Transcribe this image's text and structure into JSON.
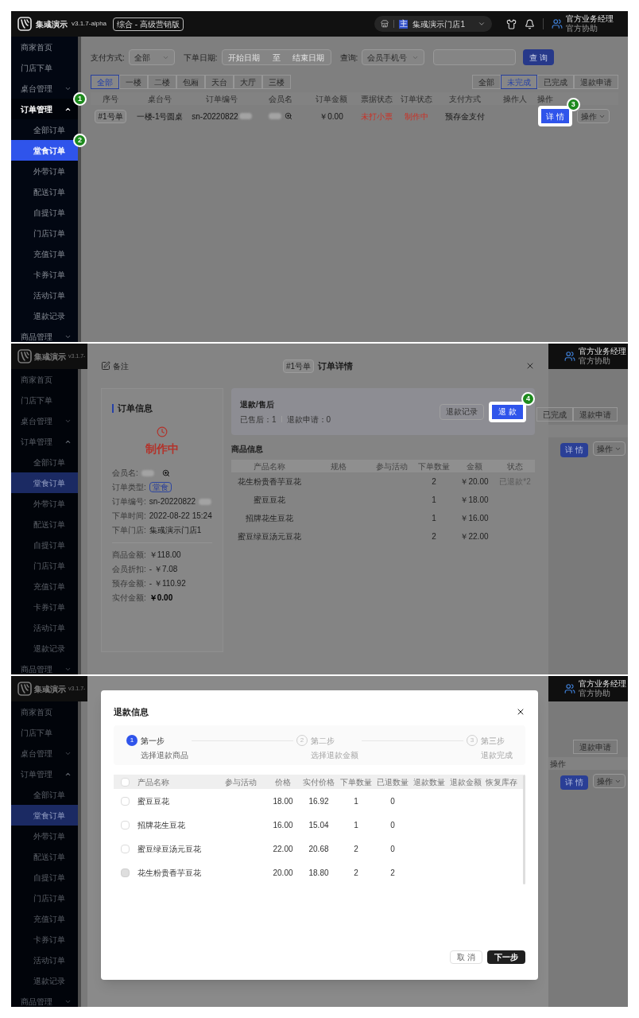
{
  "list_screen": {
    "header": {
      "app_name": "集彧演示",
      "version": "v3.1.7-alpha",
      "edition": "综合 - 高级营销版",
      "store_badge": "主",
      "store": "集彧演示门店1",
      "user_name": "官方业务经理",
      "user_role": "官方协助"
    },
    "sidebar": [
      {
        "kind": "link",
        "label": "商家首页",
        "selected": false
      },
      {
        "kind": "link",
        "label": "门店下单",
        "selected": false
      },
      {
        "kind": "group",
        "label": "桌台管理",
        "expanded": false
      },
      {
        "kind": "group",
        "label": "订单管理",
        "expanded": true,
        "marker": "1",
        "children": [
          {
            "kind": "link",
            "label": "全部订单",
            "selected": false
          },
          {
            "kind": "link",
            "label": "堂食订单",
            "selected": true,
            "marker": "2"
          },
          {
            "kind": "link",
            "label": "外带订单",
            "selected": false
          },
          {
            "kind": "link",
            "label": "配送订单",
            "selected": false
          },
          {
            "kind": "link",
            "label": "自提订单",
            "selected": false
          },
          {
            "kind": "link",
            "label": "门店订单",
            "selected": false
          },
          {
            "kind": "link",
            "label": "充值订单",
            "selected": false
          },
          {
            "kind": "link",
            "label": "卡券订单",
            "selected": false
          },
          {
            "kind": "link",
            "label": "活动订单",
            "selected": false
          },
          {
            "kind": "link",
            "label": "退款记录",
            "selected": false
          }
        ]
      },
      {
        "kind": "group",
        "label": "商品管理",
        "expanded": false
      }
    ],
    "filters": [
      {
        "kind": "select",
        "label": "支付方式:",
        "value": "全部"
      },
      {
        "kind": "date_range",
        "label": "下单日期:",
        "start_placeholder": "开始日期",
        "separator": "至",
        "end_placeholder": "结束日期"
      },
      {
        "kind": "select",
        "label": "查询:",
        "value": "会员手机号"
      },
      {
        "kind": "text"
      }
    ],
    "search_button": "查 询",
    "area_tabs": [
      {
        "label": "全部",
        "selected": true
      },
      {
        "label": "一楼",
        "selected": false
      },
      {
        "label": "二楼",
        "selected": false
      },
      {
        "label": "包厢",
        "selected": false
      },
      {
        "label": "天台",
        "selected": false
      },
      {
        "label": "大厅",
        "selected": false
      },
      {
        "label": "三楼",
        "selected": false
      }
    ],
    "status_tabs": [
      {
        "label": "全部",
        "selected": false
      },
      {
        "label": "未完成",
        "selected": true
      },
      {
        "label": "已完成",
        "selected": false
      },
      {
        "label": "退款申请",
        "selected": false
      }
    ],
    "table": {
      "columns": [
        "序号",
        "桌台号",
        "订单编号",
        "会员名",
        "订单金额",
        "票据状态",
        "订单状态",
        "支付方式",
        "操作人",
        "操作"
      ],
      "rows": [
        {
          "cells": [
            {
              "kind": "tag",
              "text": "#1号单"
            },
            {
              "kind": "text",
              "text": "一楼-1号圆桌"
            },
            {
              "kind": "text",
              "text": "sn-20220822",
              "redacted": true
            },
            {
              "kind": "member",
              "redacted": true
            },
            {
              "kind": "text",
              "text": "￥0.00"
            },
            {
              "kind": "alert_text",
              "text": "未打小票"
            },
            {
              "kind": "alert_text",
              "text": "制作中"
            },
            {
              "kind": "text",
              "text": "预存金支付"
            },
            {
              "kind": "empty"
            },
            {
              "kind": "actions",
              "buttons": [
                {
                  "label": "详 情",
                  "kind": "primary",
                  "marker": "3"
                },
                {
                  "label": "操作",
                  "kind": "dropdown"
                }
              ]
            }
          ]
        }
      ]
    }
  },
  "detail_screen": {
    "header": {
      "app_name": "集彧演示",
      "version": "v3.1.7-",
      "user_name": "官方业务经理",
      "user_role": "官方协助"
    },
    "sidebar": [
      {
        "kind": "link",
        "label": "商家首页",
        "selected": false
      },
      {
        "kind": "link",
        "label": "门店下单",
        "selected": false
      },
      {
        "kind": "group",
        "label": "桌台管理",
        "expanded": false
      },
      {
        "kind": "group",
        "label": "订单管理",
        "expanded": true,
        "children": [
          {
            "kind": "link",
            "label": "全部订单",
            "selected": false
          },
          {
            "kind": "link",
            "label": "堂食订单",
            "selected": true
          },
          {
            "kind": "link",
            "label": "外带订单",
            "selected": false
          },
          {
            "kind": "link",
            "label": "配送订单",
            "selected": false
          },
          {
            "kind": "link",
            "label": "自提订单",
            "selected": false
          },
          {
            "kind": "link",
            "label": "门店订单",
            "selected": false
          },
          {
            "kind": "link",
            "label": "充值订单",
            "selected": false
          },
          {
            "kind": "link",
            "label": "卡券订单",
            "selected": false
          },
          {
            "kind": "link",
            "label": "活动订单",
            "selected": false
          },
          {
            "kind": "link",
            "label": "退款记录",
            "selected": false
          }
        ]
      },
      {
        "kind": "group",
        "label": "商品管理",
        "expanded": false
      }
    ],
    "right_strip": {
      "status_tabs": [
        {
          "label": "已完成",
          "selected": false
        },
        {
          "label": "退款申请",
          "selected": false
        }
      ],
      "row_buttons": [
        {
          "label": "详 情",
          "kind": "primary"
        },
        {
          "label": "操作",
          "kind": "dropdown"
        }
      ]
    },
    "modal": {
      "note_label": "备注",
      "order_tag": "#1号单",
      "title": "订单详情",
      "info_title": "订单信息",
      "status": "制作中",
      "fields": [
        {
          "label": "会员名:",
          "kind": "member",
          "redacted": true
        },
        {
          "label": "订单类型:",
          "kind": "tag",
          "value": "堂食"
        },
        {
          "label": "订单编号:",
          "kind": "text",
          "value": "sn-20220822",
          "redacted": true
        },
        {
          "label": "下单时间:",
          "kind": "text",
          "value": "2022-08-22 15:24"
        },
        {
          "label": "下单门店:",
          "kind": "text",
          "value": "集彧演示门店1"
        }
      ],
      "amounts": [
        {
          "label": "商品金额:",
          "value": "￥118.00",
          "emphasis": false
        },
        {
          "label": "会员折扣:",
          "value": "- ￥7.08",
          "emphasis": false
        },
        {
          "label": "预存金额:",
          "value": "- ￥110.92",
          "emphasis": false
        },
        {
          "label": "实付金额:",
          "value": "￥0.00",
          "emphasis": true
        }
      ],
      "refund": {
        "title": "退款/售后",
        "stats": [
          "已售后：1",
          "退款申请：0"
        ],
        "buttons": [
          {
            "label": "退款记录",
            "kind": "secondary"
          },
          {
            "label": "退 款",
            "kind": "primary",
            "marker": "4"
          }
        ]
      },
      "goods_title": "商品信息",
      "goods_table": {
        "columns": [
          "产品名称",
          "规格",
          "参与活动",
          "下单数量",
          "金额",
          "状态"
        ],
        "rows": [
          {
            "name": "花生粉贵香芋豆花",
            "quantity": "2",
            "amount": "￥20.00",
            "status": "已退款*2"
          },
          {
            "name": "蜜豆豆花",
            "quantity": "1",
            "amount": "￥18.00"
          },
          {
            "name": "招牌花生豆花",
            "quantity": "1",
            "amount": "￥16.00"
          },
          {
            "name": "蜜豆绿豆汤元豆花",
            "quantity": "2",
            "amount": "￥22.00"
          }
        ]
      }
    }
  },
  "refund_screen": {
    "header": {
      "app_name": "集彧演示",
      "version": "v3.1.7-",
      "user_name": "官方业务经理",
      "user_role": "官方协助"
    },
    "sidebar": [
      {
        "kind": "link",
        "label": "商家首页",
        "selected": false
      },
      {
        "kind": "link",
        "label": "门店下单",
        "selected": false
      },
      {
        "kind": "group",
        "label": "桌台管理",
        "expanded": false
      },
      {
        "kind": "group",
        "label": "订单管理",
        "expanded": true,
        "children": [
          {
            "kind": "link",
            "label": "全部订单",
            "selected": false
          },
          {
            "kind": "link",
            "label": "堂食订单",
            "selected": true
          },
          {
            "kind": "link",
            "label": "外带订单",
            "selected": false
          },
          {
            "kind": "link",
            "label": "配送订单",
            "selected": false
          },
          {
            "kind": "link",
            "label": "自提订单",
            "selected": false
          },
          {
            "kind": "link",
            "label": "门店订单",
            "selected": false
          },
          {
            "kind": "link",
            "label": "充值订单",
            "selected": false
          },
          {
            "kind": "link",
            "label": "卡券订单",
            "selected": false
          },
          {
            "kind": "link",
            "label": "活动订单",
            "selected": false
          },
          {
            "kind": "link",
            "label": "退款记录",
            "selected": false
          }
        ]
      },
      {
        "kind": "group",
        "label": "商品管理",
        "expanded": false
      }
    ],
    "right_strip": {
      "status_tabs": [
        {
          "label": "退款申请",
          "selected": false
        }
      ],
      "column_label": "操作",
      "row_buttons": [
        {
          "label": "详 情",
          "kind": "primary"
        },
        {
          "label": "操作",
          "kind": "dropdown"
        }
      ]
    },
    "dialog": {
      "title": "退款信息",
      "steps": [
        {
          "number": "1",
          "title": "第一步",
          "subtitle": "选择退款商品",
          "current": true
        },
        {
          "number": "2",
          "title": "第二步",
          "subtitle": "选择退款金额",
          "current": false
        },
        {
          "number": "3",
          "title": "第三步",
          "subtitle": "退款完成",
          "current": false
        }
      ],
      "table": {
        "select_all_checked": false,
        "columns": [
          "产品名称",
          "参与活动",
          "价格",
          "实付价格",
          "下单数量",
          "已退数量",
          "退款数量",
          "退款金额",
          "恢复库存"
        ],
        "rows": [
          {
            "checked": false,
            "disabled": false,
            "name": "蜜豆豆花",
            "price": "18.00",
            "paid": "16.92",
            "quantity": "1",
            "refunded": "0"
          },
          {
            "checked": false,
            "disabled": false,
            "name": "招牌花生豆花",
            "price": "16.00",
            "paid": "15.04",
            "quantity": "1",
            "refunded": "0"
          },
          {
            "checked": false,
            "disabled": false,
            "name": "蜜豆绿豆汤元豆花",
            "price": "22.00",
            "paid": "20.68",
            "quantity": "2",
            "refunded": "0"
          },
          {
            "checked": false,
            "disabled": true,
            "name": "花生粉贵香芋豆花",
            "price": "20.00",
            "paid": "18.80",
            "quantity": "2",
            "refunded": "2"
          }
        ]
      },
      "buttons": [
        {
          "label": "取 消",
          "kind": "secondary"
        },
        {
          "label": "下一步",
          "kind": "primary"
        }
      ]
    }
  }
}
